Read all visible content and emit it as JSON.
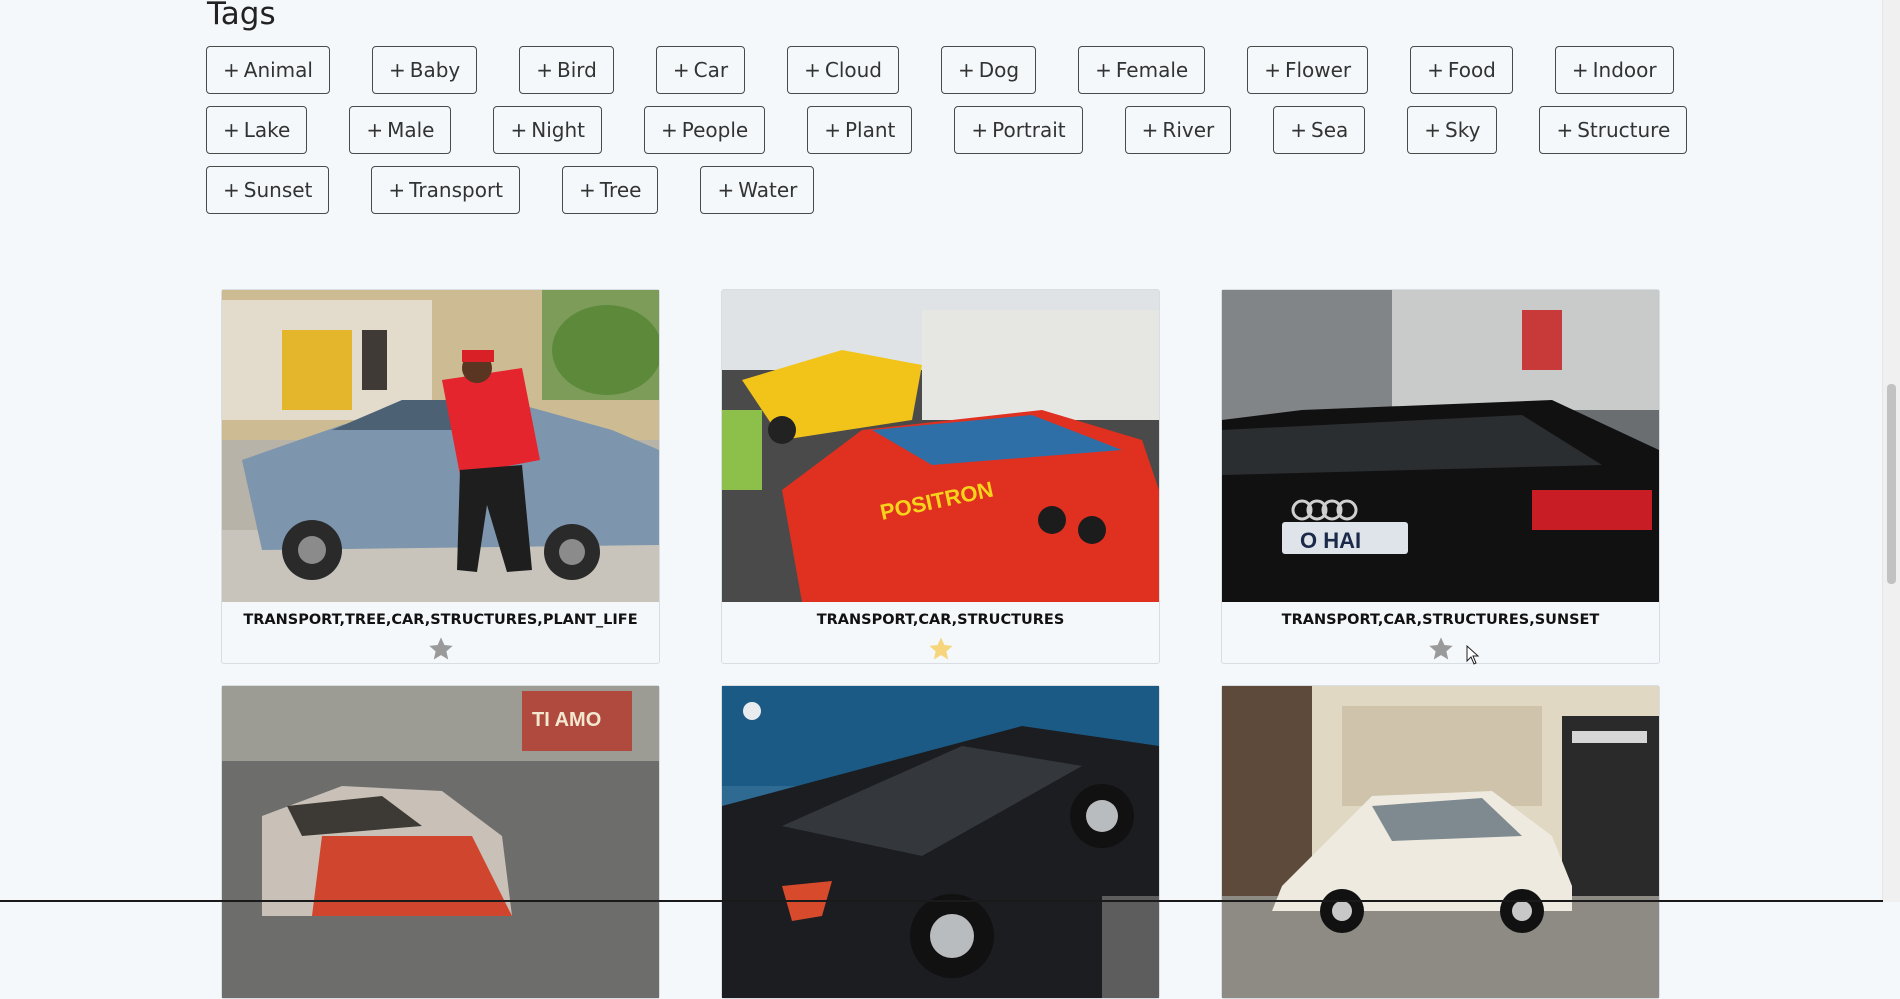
{
  "tags_section": {
    "title": "Tags",
    "plus": "+",
    "rows": [
      [
        "Animal",
        "Baby",
        "Bird",
        "Car",
        "Cloud",
        "Dog",
        "Female",
        "Flower",
        "Food",
        "Indoor"
      ],
      [
        "Lake",
        "Male",
        "Night",
        "People",
        "Plant",
        "Portrait",
        "River",
        "Sea",
        "Sky",
        "Structure"
      ],
      [
        "Sunset",
        "Transport",
        "Tree",
        "Water"
      ]
    ]
  },
  "cards": [
    {
      "caption": "TRANSPORT,TREE,CAR,STRUCTURES,PLANT_LIFE",
      "favorited": false,
      "image": "man-leaning-on-blue-sedan"
    },
    {
      "caption": "TRANSPORT,CAR,STRUCTURES",
      "favorited": true,
      "image": "red-ferrari-positron"
    },
    {
      "caption": "TRANSPORT,CAR,STRUCTURES,SUNSET",
      "favorited": false,
      "image": "black-audi-o-hai-plate"
    },
    {
      "caption": "",
      "favorited": false,
      "image": "burned-out-car"
    },
    {
      "caption": "",
      "favorited": false,
      "image": "black-sports-car-tilted"
    },
    {
      "caption": "",
      "favorited": false,
      "image": "white-citroen-ds"
    }
  ],
  "colors": {
    "star_on": "#f7d57c",
    "star_off": "#9a9a9a",
    "page_bg": "#f4f8fb"
  }
}
